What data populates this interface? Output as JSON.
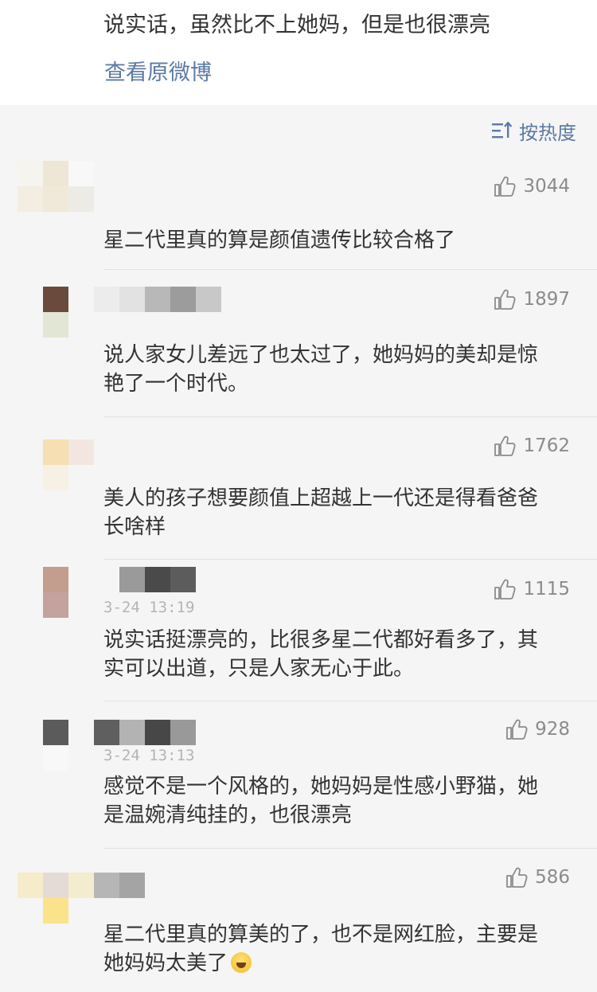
{
  "top": {
    "text": "说实话，虽然比不上她妈，但是也很漂亮",
    "view_original": "查看原微博"
  },
  "sort": {
    "label": "按热度",
    "icon": "sort-icon"
  },
  "comments": [
    {
      "text": "星二代里真的算是颜值遗传比较合格了",
      "likes": "3044",
      "timestamp": ""
    },
    {
      "text": "说人家女儿差远了也太过了，她妈妈的美却是惊艳了一个时代。",
      "likes": "1897",
      "timestamp": ""
    },
    {
      "text": "美人的孩子想要颜值上超越上一代还是得看爸爸长啥样",
      "likes": "1762",
      "timestamp": ""
    },
    {
      "text": "说实话挺漂亮的，比很多星二代都好看多了，其实可以出道，只是人家无心于此。",
      "likes": "1115",
      "timestamp": "3-24 13:19"
    },
    {
      "text": "感觉不是一个风格的，她妈妈是性感小野猫，她是温婉清纯挂的，也很漂亮",
      "likes": "928",
      "timestamp": "3-24 13:13"
    },
    {
      "text": "星二代里真的算美的了，也不是网红脸，主要是她妈妈太美了",
      "likes": "586",
      "timestamp": "",
      "emoji": "laugh-cry-emoji"
    }
  ],
  "colors": {
    "link": "#5b7aa3",
    "text": "#333333",
    "meta": "#8b8b8b",
    "background": "#f5f5f5"
  }
}
